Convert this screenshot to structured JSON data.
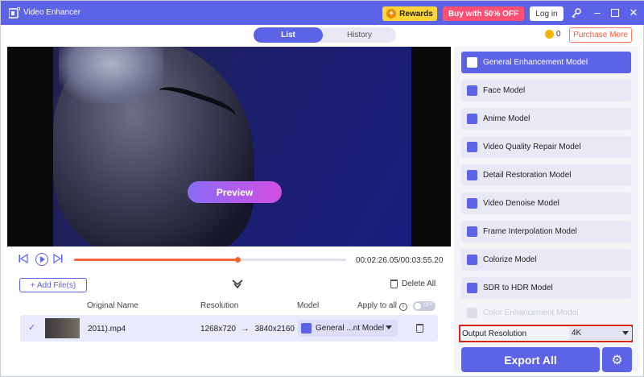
{
  "window": {
    "title": "Video Enhancer",
    "rewards_label": "Rewards",
    "buy_label": "Buy with 50% OFF",
    "login_label": "Log in"
  },
  "tabs": [
    {
      "label": "List",
      "active": true
    },
    {
      "label": "History",
      "active": false
    }
  ],
  "credits": {
    "count": "0",
    "purchase_label": "Purchase More"
  },
  "preview": {
    "button_label": "Preview"
  },
  "playback": {
    "time_display": "00:02:26.05/00:03:55.20",
    "progress": 0.6
  },
  "list": {
    "add_files_label": "+ Add File(s)",
    "delete_all_label": "Delete All",
    "headers": {
      "original_name": "Original Name",
      "resolution": "Resolution",
      "model": "Model",
      "apply_to_all": "Apply to all",
      "toggle_state": "OFF"
    },
    "rows": [
      {
        "name": "2011).mp4",
        "resolution_from": "1268x720",
        "resolution_arrow": "→",
        "resolution_to": "3840x2160",
        "model": "General ...nt Model"
      }
    ]
  },
  "models": [
    {
      "label": "General Enhancement Model",
      "active": true
    },
    {
      "label": "Face Model",
      "active": false
    },
    {
      "label": "Anime Model",
      "active": false
    },
    {
      "label": "Video Quality Repair Model",
      "active": false
    },
    {
      "label": "Detail Restoration Model",
      "active": false
    },
    {
      "label": "Video Denoise Model",
      "active": false
    },
    {
      "label": "Frame Interpolation Model",
      "active": false
    },
    {
      "label": "Colorize Model",
      "active": false
    },
    {
      "label": "SDR to HDR Model",
      "active": false
    },
    {
      "label": "Color Enhancement Model",
      "active": false
    }
  ],
  "output": {
    "label": "Output Resolution",
    "value": "4K"
  },
  "export_label": "Export All",
  "colors": {
    "accent": "#5d63e6",
    "buy": "#ff4f73",
    "rewards": "#ffd43b",
    "progress": "#f0663a",
    "highlight_box": "#d9261c"
  }
}
